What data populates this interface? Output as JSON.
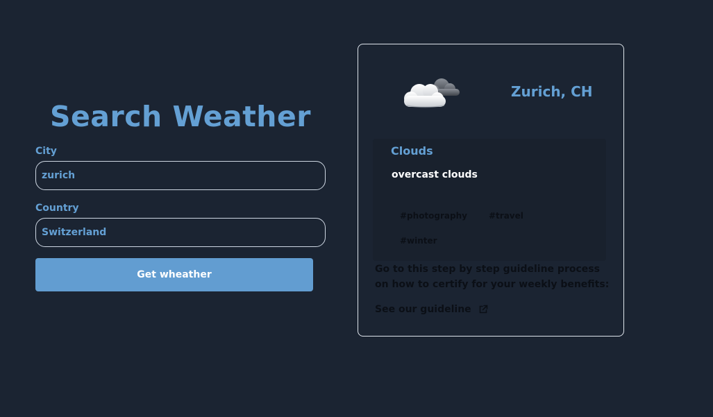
{
  "form": {
    "title": "Search Weather",
    "city_label": "City",
    "city_value": "zurich",
    "country_label": "Country",
    "country_value": "Switzerland",
    "submit_label": "Get wheather"
  },
  "card": {
    "icon": "cloud-icon",
    "location": "Zurich, CH",
    "condition": "Clouds",
    "description": "overcast clouds",
    "tags": [
      "#photography",
      "#travel",
      "#winter"
    ],
    "guide_text": "Go to this step by step guideline process on how to certify for your weekly benefits:",
    "guide_link": "See our guideline",
    "guide_link_icon": "external-link-icon"
  },
  "colors": {
    "background": "#1b2432",
    "accent": "#64a0d4",
    "button": "#629dd1",
    "card_border": "#dfe5ec"
  }
}
